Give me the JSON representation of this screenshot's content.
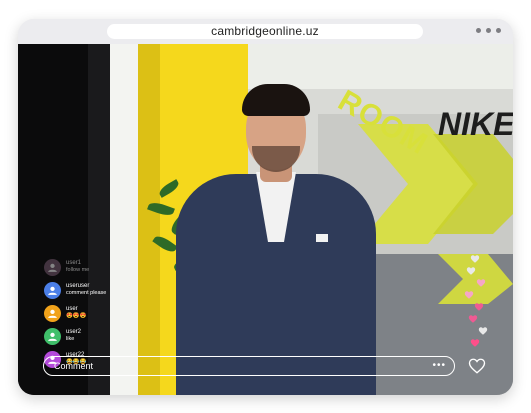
{
  "browser": {
    "url": "cambridgeonline.uz"
  },
  "live": {
    "comments": [
      {
        "user": "user1",
        "message": "follow me",
        "avatar_color": "#7a5b73",
        "faded": true
      },
      {
        "user": "useruser",
        "message": "comment please",
        "avatar_color": "#4b7fe8",
        "faded": false
      },
      {
        "user": "user",
        "message": "😍😍😍",
        "avatar_color": "#f1a21a",
        "faded": false
      },
      {
        "user": "user2",
        "message": "like",
        "avatar_color": "#3fbf6a",
        "faded": false
      },
      {
        "user": "user22",
        "message": "😂😂😂",
        "avatar_color": "#b34ad9",
        "faded": false
      }
    ],
    "comment_input": {
      "placeholder": "Comment",
      "more_icon": "more-dots-icon"
    },
    "like_icon": "heart-icon",
    "floating_hearts": [
      {
        "color": "#e9e9e9"
      },
      {
        "color": "#e9e9e9"
      },
      {
        "color": "#f6a6c7"
      },
      {
        "color": "#f6a6c7"
      },
      {
        "color": "#ef5a93"
      },
      {
        "color": "#ef5a93"
      },
      {
        "color": "#e9e9e9"
      },
      {
        "color": "#ff4f8a"
      }
    ]
  },
  "scene": {
    "wall_text": "ROOM",
    "sign_text": "NIKE",
    "accent": "#d8e03a"
  }
}
